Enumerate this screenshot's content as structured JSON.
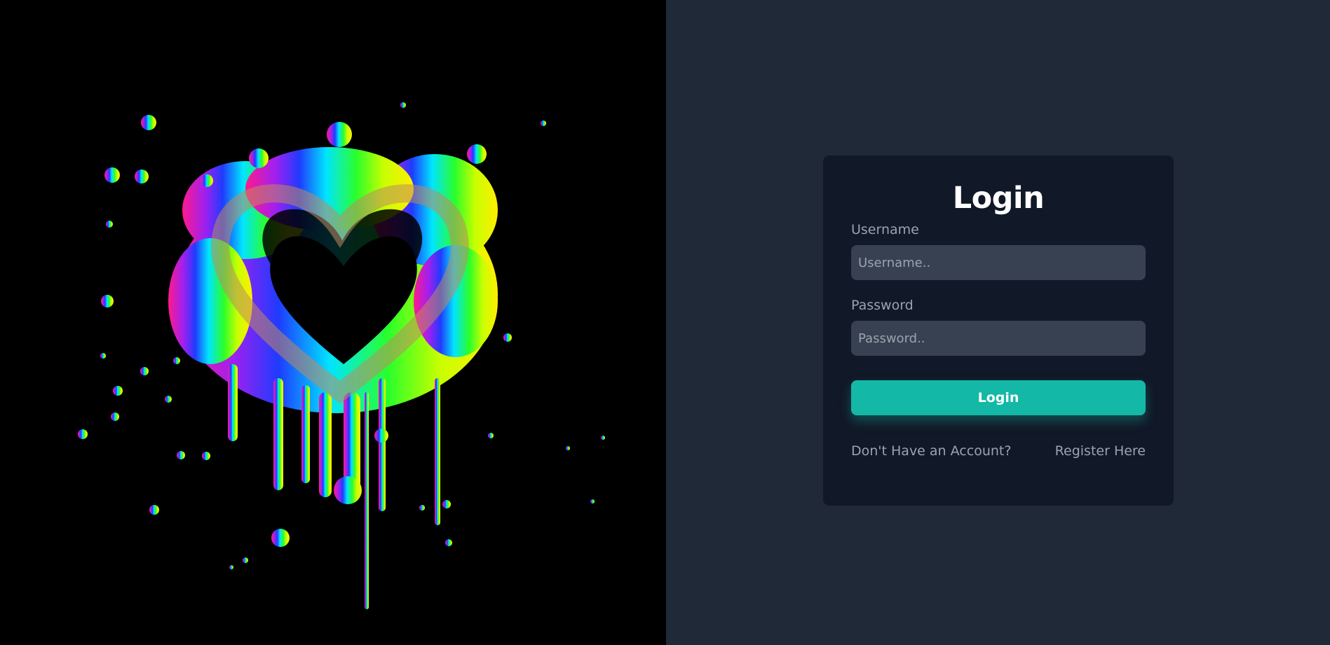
{
  "hero": {
    "image": "rainbow-paint-splash-heart",
    "background_color": "#000000"
  },
  "colors": {
    "page_background": "#1f2937",
    "card_background": "#111827",
    "input_background": "#374151",
    "accent": "#14b8a6",
    "text_muted": "#9ca3af",
    "text_title": "#ffffff"
  },
  "login": {
    "title": "Login",
    "username": {
      "label": "Username",
      "placeholder": "Username..",
      "value": ""
    },
    "password": {
      "label": "Password",
      "placeholder": "Password..",
      "value": ""
    },
    "submit_label": "Login",
    "no_account_text": "Don't Have an Account?",
    "register_link": "Register Here"
  }
}
